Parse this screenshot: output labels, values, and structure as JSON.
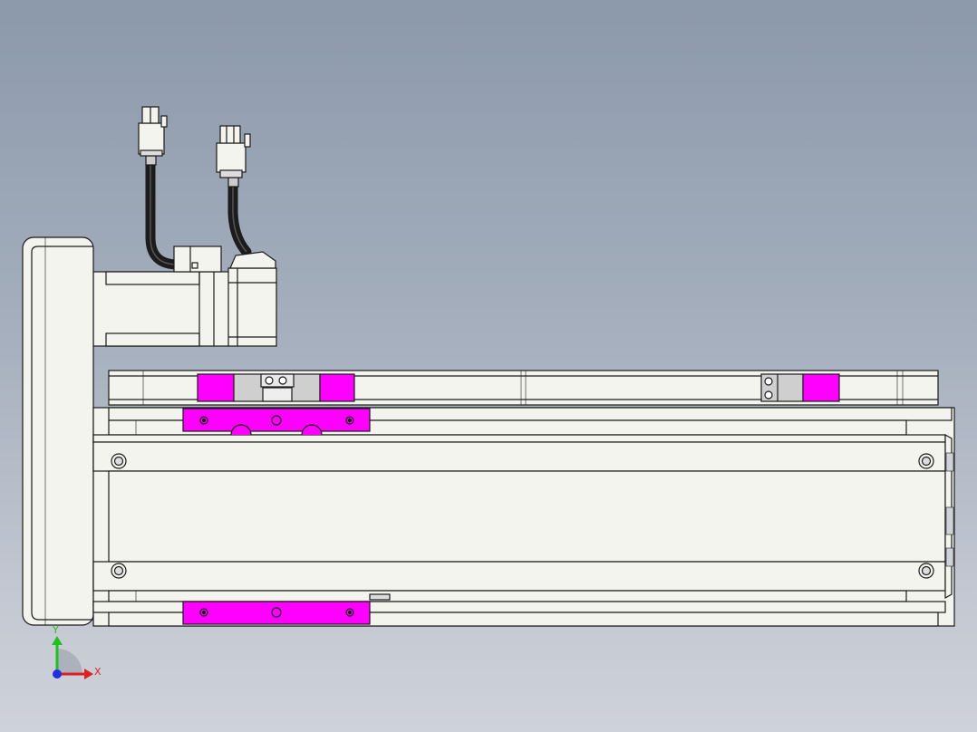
{
  "viewport": {
    "background_top": "#8c99ab",
    "background_bottom": "#cfd2da"
  },
  "model": {
    "outline_color": "#1a1a1a",
    "body_color": "#f4f4ee",
    "highlight_color": "#ff00ff",
    "cable_color": "#1c1c1c"
  },
  "triad": {
    "x_label": "X",
    "y_label": "Y",
    "x_color": "#e02020",
    "y_color": "#20c020",
    "origin_color": "#2030e0"
  }
}
